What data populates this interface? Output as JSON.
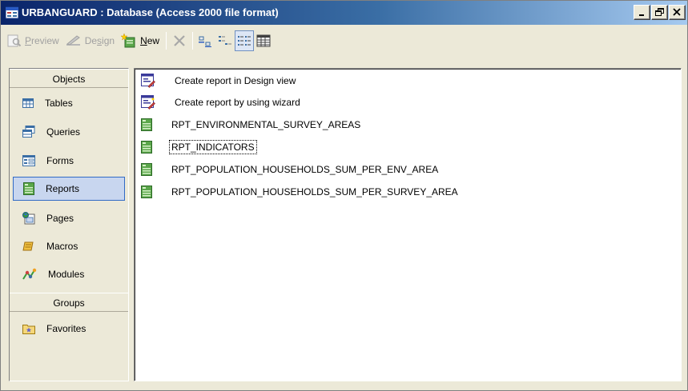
{
  "window": {
    "title": "URBANGUARD : Database (Access 2000 file format)"
  },
  "toolbar": {
    "preview_label": "Preview",
    "preview_key": "P",
    "preview_rest": "review",
    "design_label": "Design",
    "design_pre": "De",
    "design_key": "s",
    "design_rest": "ign",
    "new_key": "N",
    "new_rest": "ew"
  },
  "objects_bar": {
    "objects_header": "Objects",
    "groups_header": "Groups",
    "items": [
      {
        "label": "Tables",
        "icon": "tables-icon"
      },
      {
        "label": "Queries",
        "icon": "queries-icon"
      },
      {
        "label": "Forms",
        "icon": "forms-icon"
      },
      {
        "label": "Reports",
        "icon": "reports-icon"
      },
      {
        "label": "Pages",
        "icon": "pages-icon"
      },
      {
        "label": "Macros",
        "icon": "macros-icon"
      },
      {
        "label": "Modules",
        "icon": "modules-icon"
      }
    ],
    "groups": [
      {
        "label": "Favorites",
        "icon": "favorites-icon"
      }
    ],
    "selected": "Reports"
  },
  "list": {
    "items": [
      {
        "label": "Create report in Design view",
        "icon": "create-design-icon"
      },
      {
        "label": "Create report by using wizard",
        "icon": "create-wizard-icon"
      },
      {
        "label": "RPT_ENVIRONMENTAL_SURVEY_AREAS",
        "icon": "report-icon"
      },
      {
        "label": "RPT_INDICATORS",
        "icon": "report-icon"
      },
      {
        "label": "RPT_POPULATION_HOUSEHOLDS_SUM_PER_ENV_AREA",
        "icon": "report-icon"
      },
      {
        "label": "RPT_POPULATION_HOUSEHOLDS_SUM_PER_SURVEY_AREA",
        "icon": "report-icon"
      }
    ],
    "focused": "RPT_INDICATORS"
  },
  "colors": {
    "titlebar_start": "#0a246a",
    "titlebar_end": "#a6caf0",
    "selection_border": "#316ac5",
    "window_bg": "#ece9d8"
  }
}
